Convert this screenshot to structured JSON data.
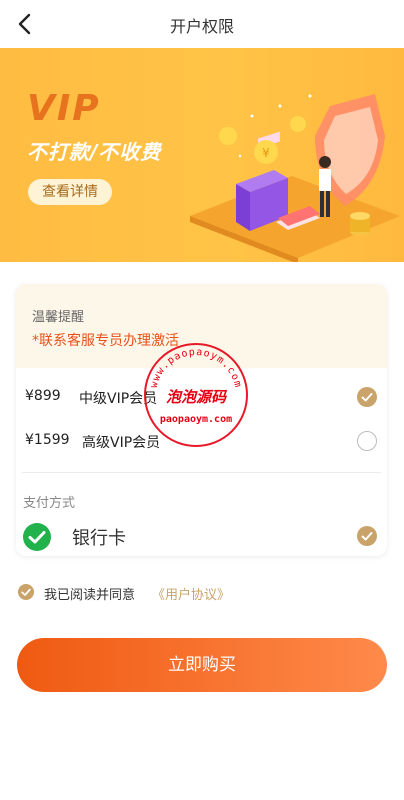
{
  "header": {
    "title": "开户权限"
  },
  "banner": {
    "vip_text": "VIP",
    "slogan": "不打款/不收费",
    "detail_button": "查看详情"
  },
  "notice": {
    "title": "温馨提醒",
    "text": "*联系客服专员办理激活"
  },
  "plans": [
    {
      "price": "¥899",
      "name": "中级VIP会员",
      "selected": true
    },
    {
      "price": "¥1599",
      "name": "高级VIP会员",
      "selected": false
    }
  ],
  "payment": {
    "title": "支付方式",
    "method": "银行卡",
    "selected": true
  },
  "agreement": {
    "text": "我已阅读并同意",
    "link": "《用户协议》",
    "checked": true
  },
  "buy_button": "立即购买",
  "watermark": {
    "top_text": "www.paopaoym.com",
    "center_text": "泡泡源码",
    "bottom_text": "paopaoym.com"
  },
  "colors": {
    "accent_gold": "#c9a36a",
    "notice_red": "#e8521a",
    "button_start": "#ef5a12",
    "button_end": "#ff8a4a",
    "banner_bg": "#ffbc42"
  }
}
